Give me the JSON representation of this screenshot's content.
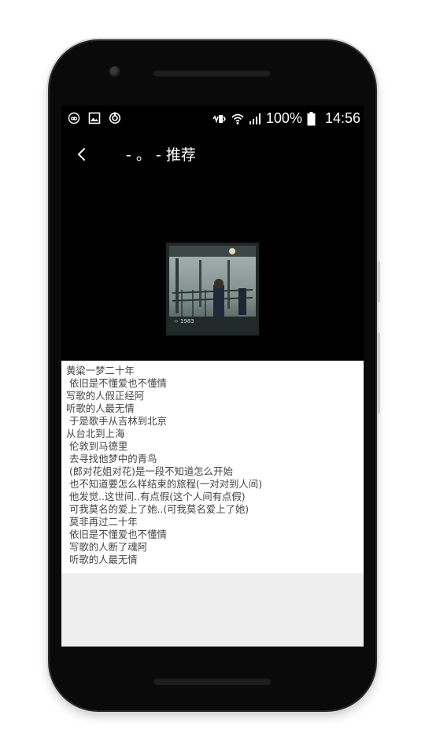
{
  "status_bar": {
    "battery": "100%",
    "time": "14:56",
    "left_icons": [
      "game-controller-icon",
      "image-icon",
      "sync-icon"
    ],
    "right_icons": [
      "vibrate-icon",
      "wifi-icon",
      "signal-icon",
      "battery-icon"
    ]
  },
  "toolbar": {
    "back_icon": "chevron-left-icon",
    "title": "- 。 - 推荐"
  },
  "album": {
    "cover_icon": "album-cover-image"
  },
  "lyrics": [
    "黄粱一梦二十年",
    " 依旧是不懂爱也不懂情",
    "写歌的人假正经阿",
    "听歌的人最无情",
    " 于是歌手从吉林到北京",
    "从台北到上海",
    " 伦敦到马德里",
    " 去寻找他梦中的青鸟",
    " (郎对花姐对花)是一段不知道怎么开始",
    " 也不知道要怎么样结束的旅程(一对对到人间)",
    " 他发觉..这世间..有点假(这个人间有点假)",
    " 可我莫名的爱上了她..(可我莫名爱上了她)",
    " 莫非再过二十年",
    " 依旧是不懂爱也不懂情",
    " 写歌的人断了魂阿",
    " 听歌的人最无情"
  ],
  "colors": {
    "screen_bg": "#000000",
    "lyrics_bg": "#ffffff",
    "lyrics_text": "#444444",
    "empty_bg": "#eeeeee"
  }
}
